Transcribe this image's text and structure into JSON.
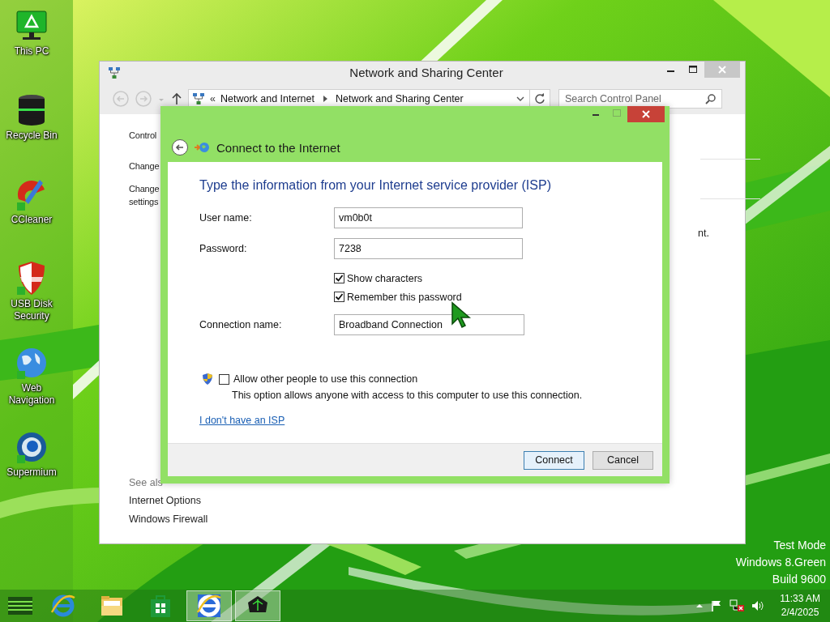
{
  "desktop_icons": [
    {
      "kind": "monitor",
      "label": "This PC"
    },
    {
      "kind": "bin",
      "label": "Recycle Bin"
    },
    {
      "kind": "brush",
      "label": "CCleaner"
    },
    {
      "kind": "shield",
      "label": "USB Disk Security"
    },
    {
      "kind": "globe",
      "label": "Web Navigation"
    },
    {
      "kind": "orb",
      "label": "Supermium"
    }
  ],
  "back_window": {
    "title": "Network and Sharing Center",
    "address": {
      "overflow": "«",
      "crumbs": [
        "Network and Internet",
        "Network and Sharing Center"
      ]
    },
    "search": {
      "placeholder": "Search Control Panel"
    },
    "left_pane": [
      "Control",
      "Change",
      "Change settings"
    ],
    "right_text": "nt.",
    "see_also": {
      "heading": "See als",
      "links": [
        "Internet Options",
        "Windows Firewall"
      ]
    }
  },
  "dialog": {
    "title": "Connect to the Internet",
    "heading": "Type the information from your Internet service provider (ISP)",
    "fields": [
      {
        "label": "User name:",
        "value": "vm0b0t"
      },
      {
        "label": "Password:",
        "value": "7238"
      }
    ],
    "options": [
      {
        "label": "Show characters",
        "checked": true
      },
      {
        "label": "Remember this password",
        "checked": true
      }
    ],
    "connection": {
      "label": "Connection name:",
      "value": "Broadband Connection"
    },
    "share": {
      "label": "Allow other people to use this connection",
      "checked": false,
      "description": "This option allows anyone with access to this computer to use this connection."
    },
    "link": "I don't have an ISP",
    "buttons": [
      {
        "label": "Connect",
        "default": true
      },
      {
        "label": "Cancel",
        "default": false
      }
    ]
  },
  "desktop_notice": [
    "Test Mode",
    "Windows 8.Green",
    "Build 9600"
  ],
  "taskbar": {
    "apps": [
      {
        "kind": "ie",
        "active": false
      },
      {
        "kind": "folder",
        "active": false
      },
      {
        "kind": "store",
        "active": false
      },
      {
        "kind": "ie",
        "active": true
      },
      {
        "kind": "orb",
        "active": true
      }
    ],
    "clock": {
      "time": "11:33 AM",
      "date": "2/4/2025"
    }
  }
}
